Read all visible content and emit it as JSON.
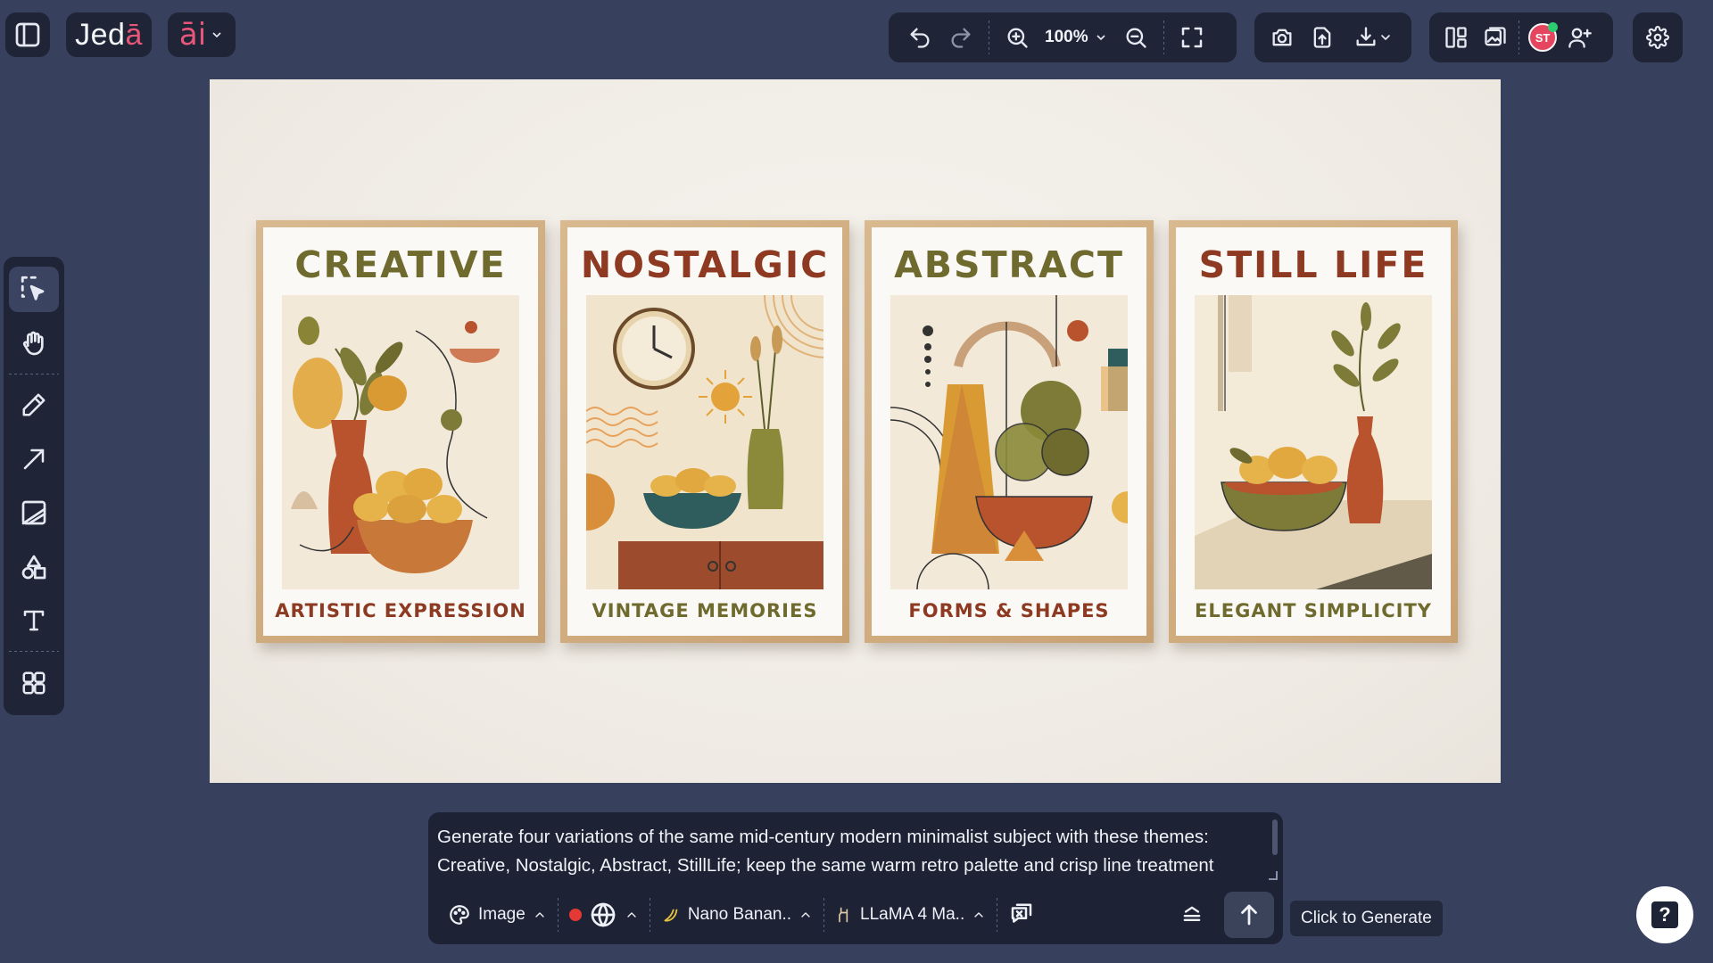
{
  "app": {
    "brand_name": "Jeda",
    "brand_accent": "ā",
    "ai_label": "āi"
  },
  "toolbar": {
    "zoom_level": "100%"
  },
  "user": {
    "initials": "ST"
  },
  "posters": [
    {
      "title": "CREATIVE",
      "subtitle": "ARTISTIC EXPRESSION",
      "title_color": "#6f6a2e",
      "subtitle_color": "#8c3a22"
    },
    {
      "title": "NOSTALGIC",
      "subtitle": "VINTAGE MEMORIES",
      "title_color": "#8e3a22",
      "subtitle_color": "#6f6a2e"
    },
    {
      "title": "ABSTRACT",
      "subtitle": "FORMS & SHAPES",
      "title_color": "#6f6a2e",
      "subtitle_color": "#8e3a22"
    },
    {
      "title": "STILL LIFE",
      "subtitle": "ELEGANT SIMPLICITY",
      "title_color": "#8e3a22",
      "subtitle_color": "#6f6a2e"
    }
  ],
  "prompt": {
    "text": "Generate four variations of the same mid-century modern minimalist subject with these themes: Creative, Nostalgic, Abstract, StillLife; keep the same warm retro palette and crisp line treatment",
    "mode_label": "Image",
    "image_model_label": "Nano Banan..",
    "text_model_label": "LLaMA 4 Ma.."
  },
  "generate_tooltip": "Click to Generate",
  "help_label": "?",
  "colors": {
    "background": "#37415e",
    "panel": "#1f2537",
    "brand_accent": "#e8577a",
    "record": "#e53935"
  }
}
